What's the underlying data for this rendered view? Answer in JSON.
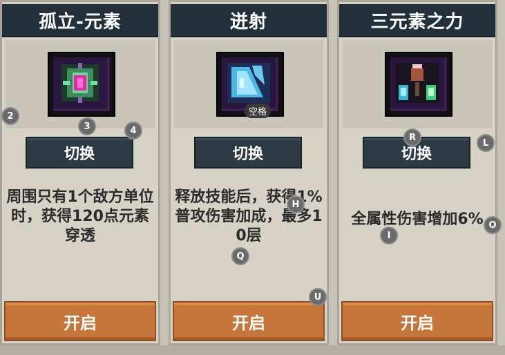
{
  "cards": [
    {
      "title": "孤立-元素",
      "switch_label": "切换",
      "description": "周围只有1个敌方单位时，获得120点元素穿透",
      "open_label": "开启",
      "icon": "element-crystal-icon"
    },
    {
      "title": "迸射",
      "switch_label": "切换",
      "description": "释放技能后，获得1%普攻伤害加成，最多10层",
      "open_label": "开启",
      "icon": "ice-burst-icon",
      "icon_key_tag": "空格"
    },
    {
      "title": "三元素之力",
      "switch_label": "切换",
      "description": "全属性伤害增加6%",
      "open_label": "开启",
      "icon": "triple-element-icon"
    }
  ],
  "hotkeys": {
    "k2": "2",
    "k3": "3",
    "k4": "4",
    "kH": "H",
    "kQ": "Q",
    "kU": "U",
    "kR": "R",
    "kL": "L",
    "kI": "I",
    "kO": "O"
  }
}
